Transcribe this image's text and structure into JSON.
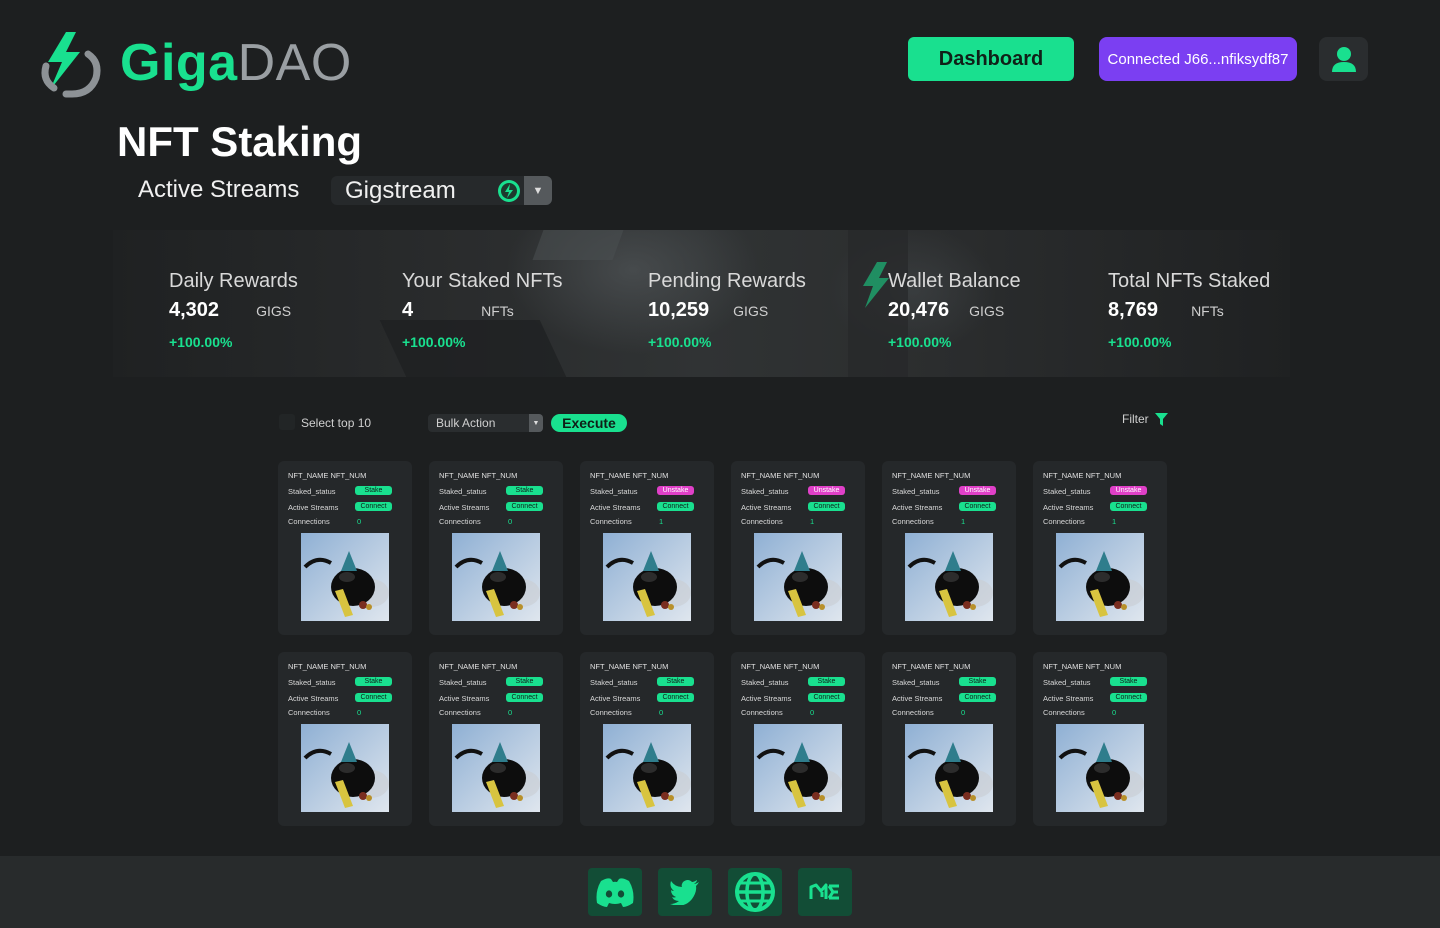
{
  "brand": {
    "name_part1": "Giga",
    "name_part2": "DAO"
  },
  "header": {
    "dashboard_label": "Dashboard",
    "wallet_label": "Connected J66...nfiksydf87"
  },
  "page": {
    "title": "NFT Staking",
    "streams_label": "Active Streams",
    "stream_selected": "Gigstream"
  },
  "stats": [
    {
      "label": "Daily Rewards",
      "value": "4,302",
      "unit": "GIGS",
      "change": "+100.00%"
    },
    {
      "label": "Your Staked NFTs",
      "value": "4",
      "unit": "NFTs",
      "change": "+100.00%"
    },
    {
      "label": "Pending Rewards",
      "value": "10,259",
      "unit": "GIGS",
      "change": "+100.00%"
    },
    {
      "label": "Wallet Balance",
      "value": "20,476",
      "unit": "GIGS",
      "change": "+100.00%"
    },
    {
      "label": "Total NFTs Staked",
      "value": "8,769",
      "unit": "NFTs",
      "change": "+100.00%"
    }
  ],
  "toolbar": {
    "select_top_label": "Select top 10",
    "bulk_action_label": "Bulk Action",
    "execute_label": "Execute",
    "filter_label": "Filter"
  },
  "card_labels": {
    "staked_status": "Staked_status",
    "active_streams": "Active Streams",
    "connections": "Connections"
  },
  "cards": [
    {
      "title": "NFT_NAME NFT_NUM",
      "status": "Stake",
      "stream": "Connect",
      "connections": "0"
    },
    {
      "title": "NFT_NAME NFT_NUM",
      "status": "Stake",
      "stream": "Connect",
      "connections": "0"
    },
    {
      "title": "NFT_NAME NFT_NUM",
      "status": "Unstake",
      "stream": "Connect",
      "connections": "1"
    },
    {
      "title": "NFT_NAME NFT_NUM",
      "status": "Unstake",
      "stream": "Connect",
      "connections": "1"
    },
    {
      "title": "NFT_NAME NFT_NUM",
      "status": "Unstake",
      "stream": "Connect",
      "connections": "1"
    },
    {
      "title": "NFT_NAME NFT_NUM",
      "status": "Unstake",
      "stream": "Connect",
      "connections": "1"
    },
    {
      "title": "NFT_NAME NFT_NUM",
      "status": "Stake",
      "stream": "Connect",
      "connections": "0"
    },
    {
      "title": "NFT_NAME NFT_NUM",
      "status": "Stake",
      "stream": "Connect",
      "connections": "0"
    },
    {
      "title": "NFT_NAME NFT_NUM",
      "status": "Stake",
      "stream": "Connect",
      "connections": "0"
    },
    {
      "title": "NFT_NAME NFT_NUM",
      "status": "Stake",
      "stream": "Connect",
      "connections": "0"
    },
    {
      "title": "NFT_NAME NFT_NUM",
      "status": "Stake",
      "stream": "Connect",
      "connections": "0"
    },
    {
      "title": "NFT_NAME NFT_NUM",
      "status": "Stake",
      "stream": "Connect",
      "connections": "0"
    }
  ],
  "footer": {
    "social_icons": [
      "discord-icon",
      "twitter-icon",
      "globe-icon",
      "magic-eden-icon"
    ]
  },
  "colors": {
    "accent": "#19e08f",
    "wallet": "#7b3ff2",
    "unstake": "#e040c8",
    "background": "#1d1f20"
  }
}
